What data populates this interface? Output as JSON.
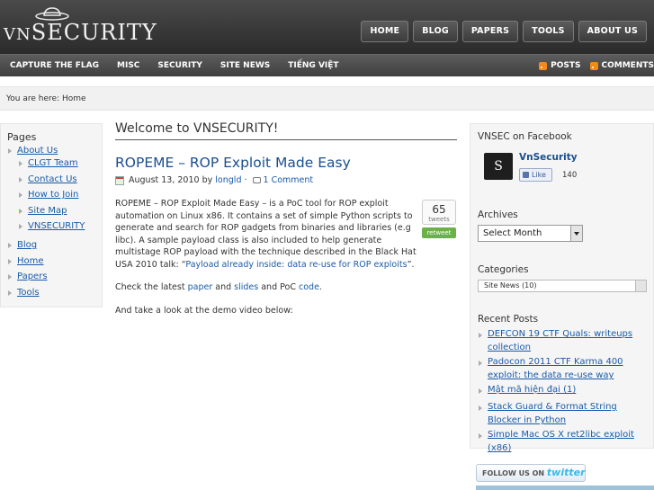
{
  "header": {
    "logo_prefix": "VN",
    "logo_suffix": "SECURITY",
    "top_nav": [
      "HOME",
      "BLOG",
      "PAPERS",
      "TOOLS",
      "ABOUT US"
    ]
  },
  "sub_nav": {
    "items": [
      "CAPTURE THE FLAG",
      "MISC",
      "SECURITY",
      "SITE NEWS",
      "TIẾNG VIỆT"
    ],
    "posts_feed": "POSTS",
    "comments_feed": "COMMENTS"
  },
  "breadcrumb": "You are here: Home",
  "left_sidebar": {
    "title": "Pages",
    "about": "About Us",
    "about_children": [
      "CLGT Team",
      "Contact Us",
      "How to Join",
      "Site Map",
      "VNSECURITY"
    ],
    "other": [
      "Blog",
      "Home",
      "Papers",
      "Tools"
    ]
  },
  "main": {
    "heading": "Welcome to VNSECURITY!",
    "post_title": "ROPEME – ROP Exploit Made Easy",
    "date": "August 13, 2010",
    "by": "by",
    "author": "longld",
    "comments": "1 Comment",
    "p1_text": "ROPEME – ROP Exploit Made Easy – is a PoC tool for ROP exploit automation on Linux x86. It contains a set of simple Python scripts to generate and search for ROP gadgets from binaries and libraries (e.g libc). A sample payload class is also included to help generate multistage ROP payload with the technique described in the Black Hat USA 2010 talk: “",
    "p1_link": "Payload already inside: data re-use for ROP exploits",
    "p1_end": "”.",
    "p2_a": "Check the latest ",
    "p2_paper": "paper",
    "p2_and": " and ",
    "p2_slides": "slides",
    "p2_and_poc": " and PoC ",
    "p2_code": "code",
    "p2_end": ".",
    "p3": "And take a look at the demo video below:",
    "tweet_count": "65",
    "tweet_label": "tweets",
    "retweet": "retweet"
  },
  "right_sidebar": {
    "facebook_title": "VNSEC on Facebook",
    "fb_name": "VnSecurity",
    "fb_like": "Like",
    "fb_count": "140",
    "archives_title": "Archives",
    "archives_select": "Select Month",
    "categories_title": "Categories",
    "categories_select": "Site News  (10)",
    "recent_title": "Recent Posts",
    "recent_posts": [
      "DEFCON 19 CTF Quals: writeups collection",
      "Padocon 2011 CTF Karma 400 exploit: the data re-use way",
      "Mật mã hiện đại (1)",
      "Stack Guard & Format String Blocker in Python",
      "Simple Mac OS X ret2libc exploit (x86)"
    ]
  },
  "twitter": {
    "prefix": "FOLLOW US ON",
    "brand": "twitter"
  }
}
